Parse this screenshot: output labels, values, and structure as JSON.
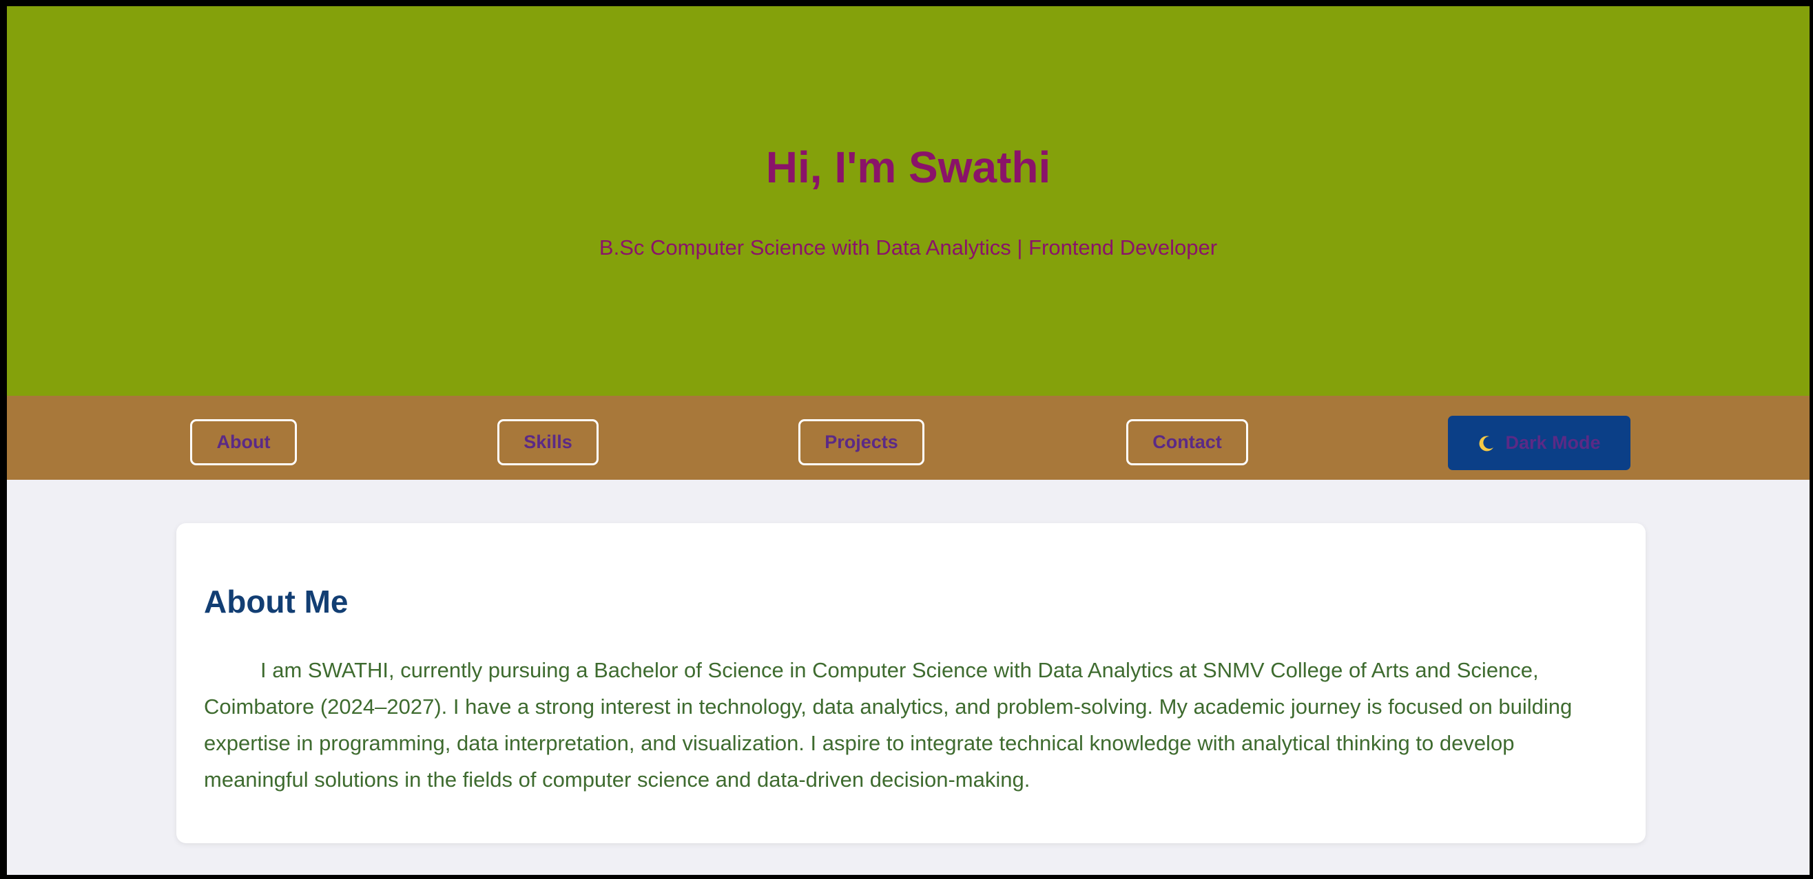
{
  "hero": {
    "title": "Hi, I'm Swathi",
    "subtitle": "B.Sc Computer Science with Data Analytics | Frontend Developer"
  },
  "nav": {
    "items": [
      {
        "label": "About"
      },
      {
        "label": "Skills"
      },
      {
        "label": "Projects"
      },
      {
        "label": "Contact"
      }
    ],
    "dark_mode": {
      "icon": "moon-icon",
      "label": "Dark Mode"
    }
  },
  "about": {
    "heading": "About Me",
    "text": "I am SWATHI, currently pursuing a Bachelor of Science in Computer Science with Data Analytics at SNMV College of Arts and Science, Coimbatore (2024–2027). I have a strong interest in technology, data analytics, and problem-solving. My academic journey is focused on building expertise in programming, data interpretation, and visualization. I aspire to integrate technical knowledge with analytical thinking to develop meaningful solutions in the fields of computer science and data-driven decision-making."
  },
  "colors": {
    "hero_bg": "#84a10b",
    "hero_text": "#8a1369",
    "nav_bg": "#a8783a",
    "nav_text": "#5b2a86",
    "dark_button_bg": "#0b3f87",
    "heading": "#123e73",
    "body_text": "#3e6b2f",
    "page_bg": "#f0f0f5"
  }
}
